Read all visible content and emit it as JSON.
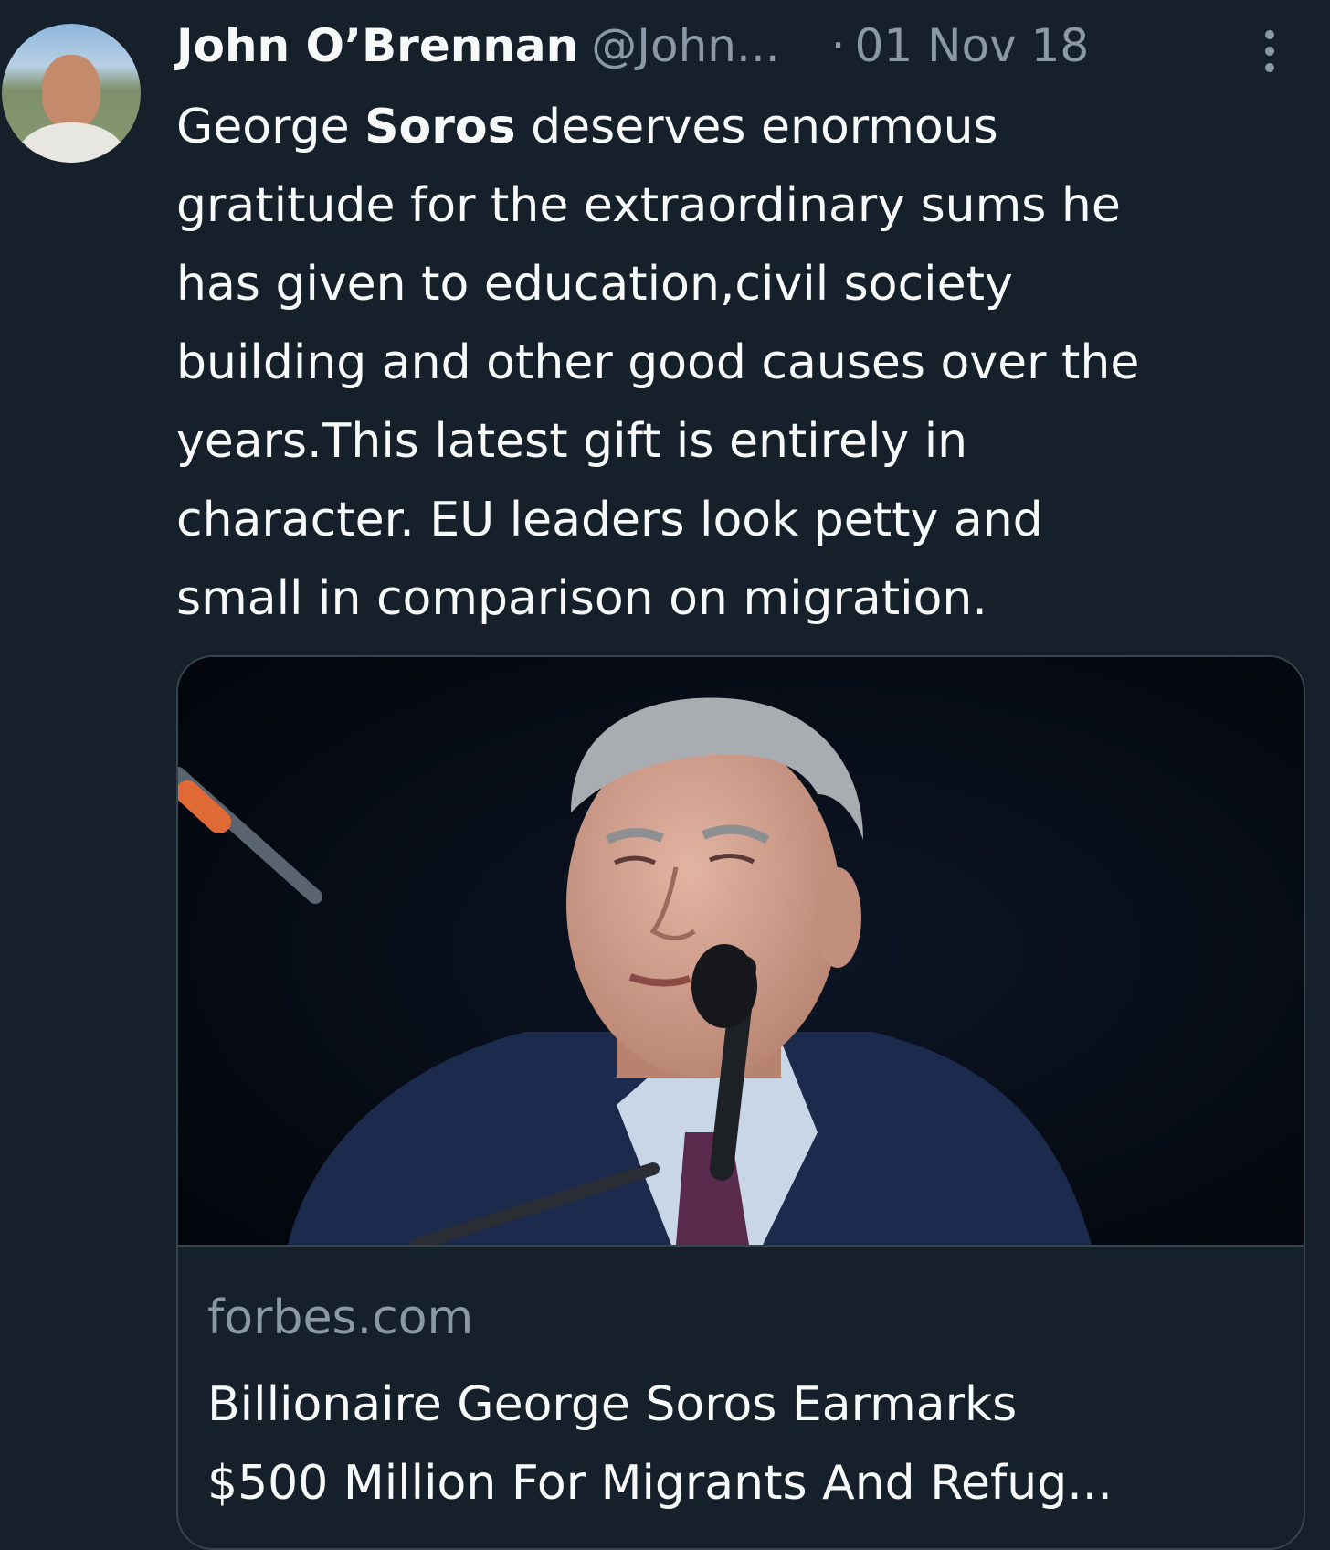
{
  "tweet": {
    "author": {
      "name": "John O’Brennan",
      "handle": "@John..."
    },
    "separator": "·",
    "date": "01 Nov 18",
    "more_icon": "more-vertical-icon",
    "text": {
      "line1_pre": "George ",
      "line1_bold": "Soros",
      "line1_post": " deserves enormous",
      "line2": "gratitude for the extraordinary sums he",
      "line3": "has given to education,civil society",
      "line4": "building and other good causes over the",
      "line5": "years.This latest gift is entirely in",
      "line6": "character. EU leaders look petty and",
      "line7": "small in comparison on migration."
    },
    "card": {
      "domain": "forbes.com",
      "title_line1": "Billionaire George Soros Earmarks",
      "title_line2": "$500 Million For Migrants And Refug..."
    }
  },
  "colors": {
    "background": "#15202b",
    "text_primary": "#f7f9f9",
    "text_secondary": "#8b98a5",
    "border": "#38444d"
  }
}
